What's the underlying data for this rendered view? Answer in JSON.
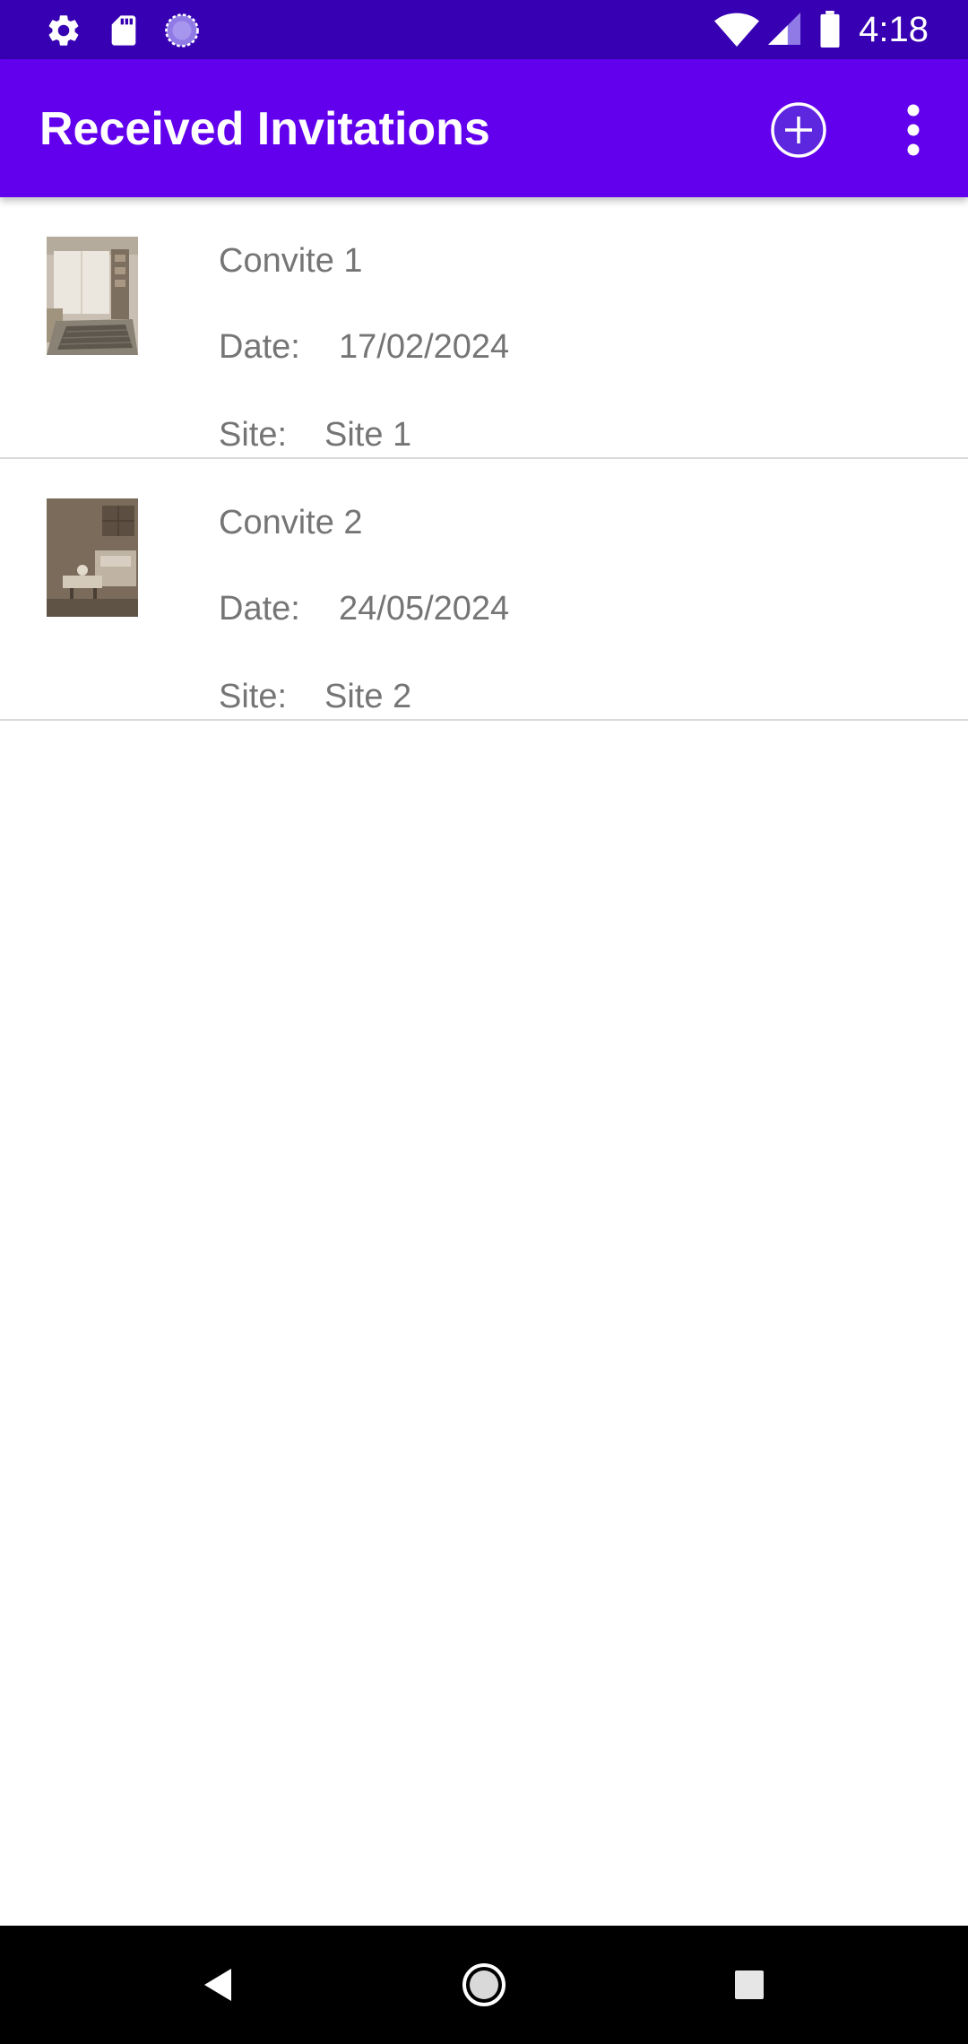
{
  "status_bar": {
    "time": "4:18",
    "left_icons": [
      "settings-icon",
      "sd-card-icon",
      "sync-circle-icon"
    ],
    "right_icons": [
      "wifi-icon",
      "cell-signal-icon",
      "battery-icon"
    ]
  },
  "app_bar": {
    "title": "Received Invitations",
    "actions": [
      "add-circle-icon",
      "more-vert-icon"
    ]
  },
  "invitations": [
    {
      "title": "Convite 1",
      "date_label": "Date:",
      "date": "17/02/2024",
      "site_label": "Site:",
      "site": "Site 1",
      "thumbnail": "room-photo-icon"
    },
    {
      "title": "Convite 2",
      "date_label": "Date:",
      "date": "24/05/2024",
      "site_label": "Site:",
      "site": "Site 2",
      "thumbnail": "room-photo-icon"
    }
  ],
  "nav_bar": {
    "buttons": [
      "back-triangle-icon",
      "home-circle-icon",
      "recents-square-icon"
    ]
  },
  "colors": {
    "status_bar": "#3700b3",
    "app_bar": "#6200ee",
    "text_secondary": "#757575",
    "divider": "#d9d9d9",
    "nav_bar": "#000000"
  }
}
